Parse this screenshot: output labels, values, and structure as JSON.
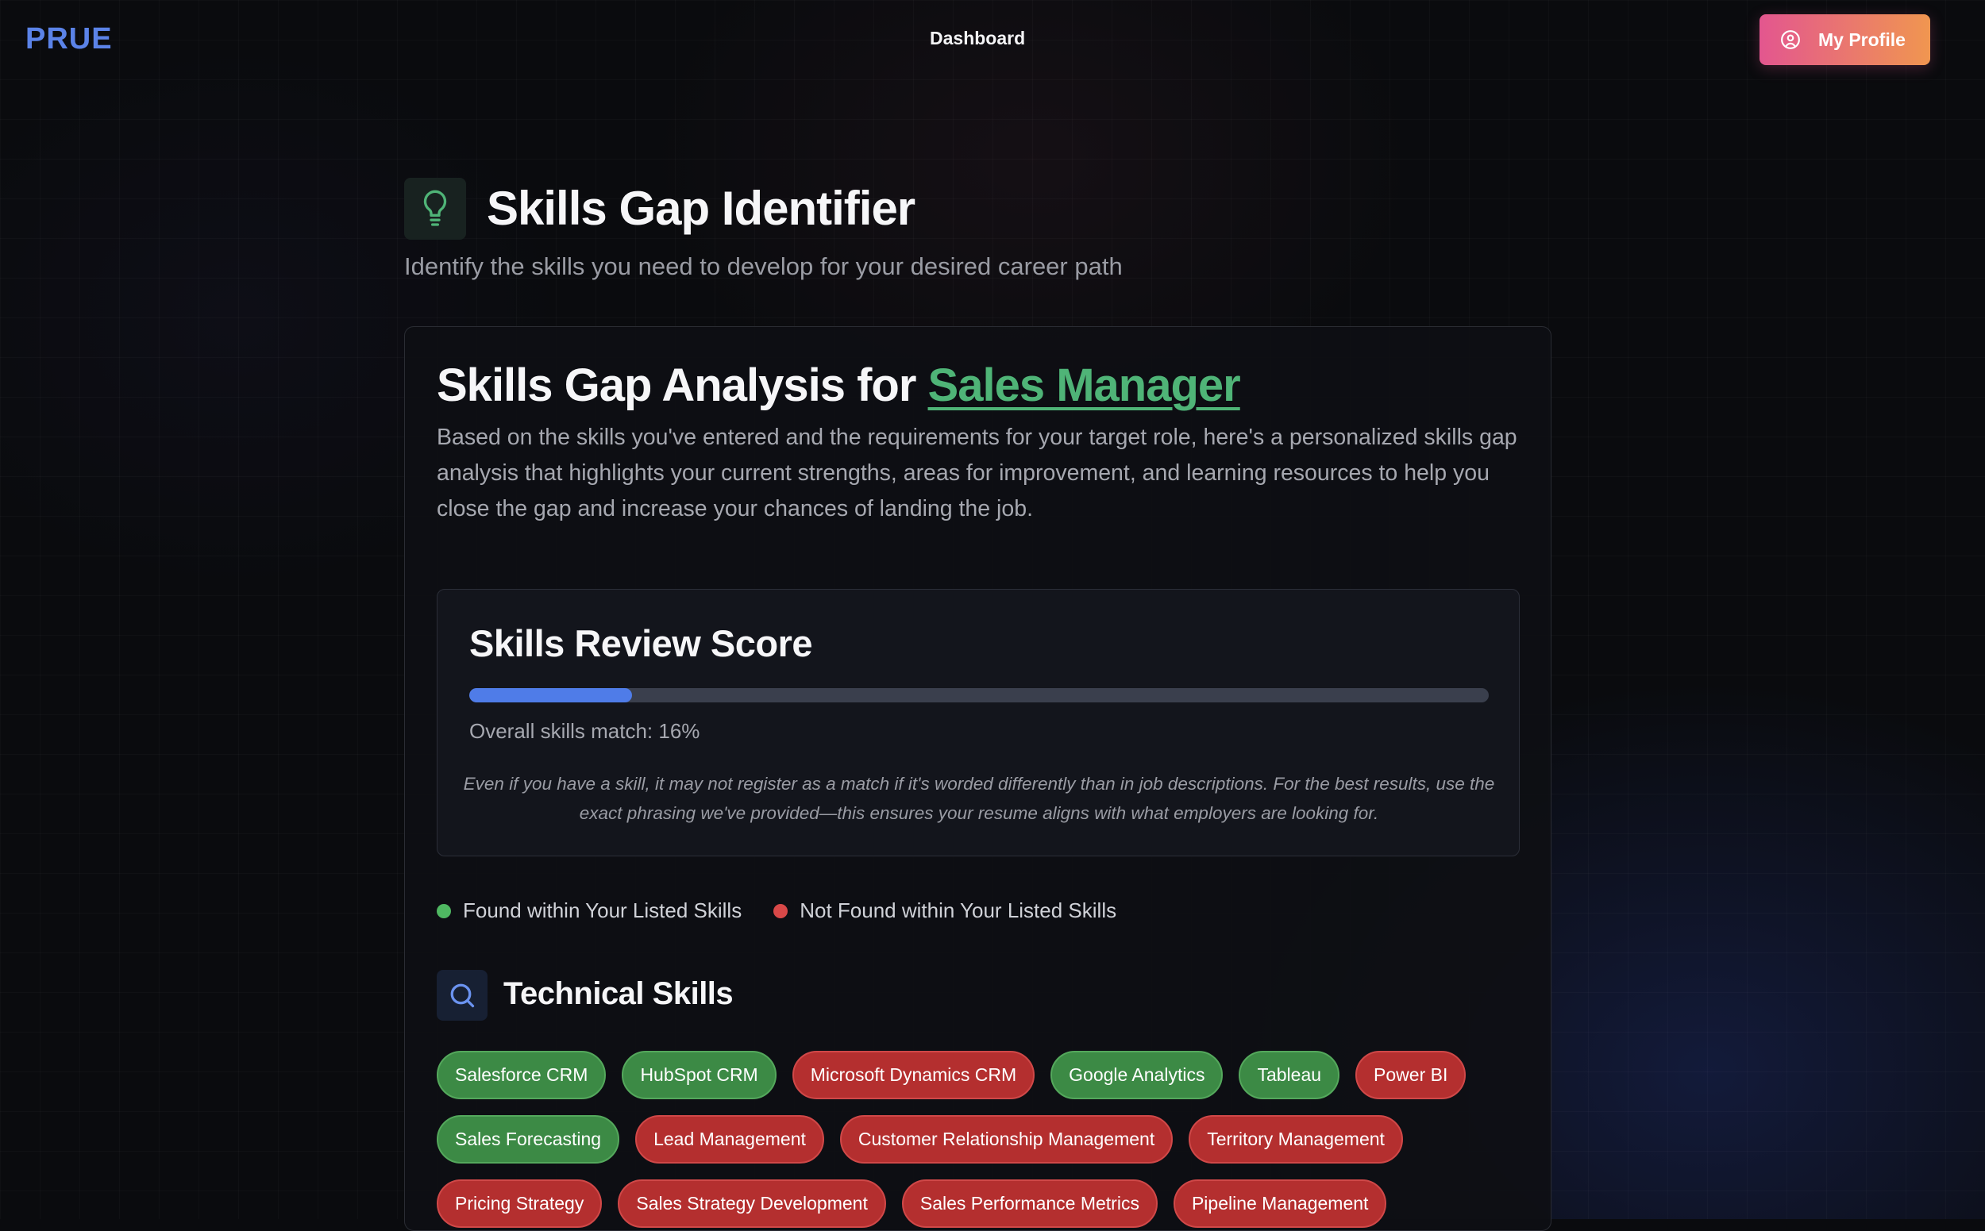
{
  "nav": {
    "logo": "PRUE",
    "link": "Dashboard",
    "profile_button": "My Profile"
  },
  "header": {
    "icon": "lightbulb-icon",
    "title": "Skills Gap Identifier",
    "subtitle": "Identify the skills you need to develop for your desired career path"
  },
  "analysis": {
    "title_prefix": "Skills Gap Analysis for ",
    "role": "Sales Manager",
    "description": "Based on the skills you've entered and the requirements for your target role, here's a personalized skills gap analysis that highlights your current strengths, areas for improvement, and learning resources to help you close the gap and increase your chances of landing the job."
  },
  "score": {
    "title": "Skills Review Score",
    "match_percent": 16,
    "match_text": "Overall skills match: 16%",
    "note": "Even if you have a skill, it may not register as a match if it's worded differently than in job descriptions. For the best results, use the exact phrasing we've provided—this ensures your resume aligns with what employers are looking for."
  },
  "legend": {
    "found": "Found within Your Listed Skills",
    "not_found": "Not Found within Your Listed Skills",
    "found_color": "#4fb862",
    "not_found_color": "#d84848"
  },
  "technical": {
    "icon": "search-icon",
    "title": "Technical Skills",
    "skills": [
      {
        "name": "Salesforce CRM",
        "found": true
      },
      {
        "name": "HubSpot CRM",
        "found": true
      },
      {
        "name": "Microsoft Dynamics CRM",
        "found": false
      },
      {
        "name": "Google Analytics",
        "found": true
      },
      {
        "name": "Tableau",
        "found": true
      },
      {
        "name": "Power BI",
        "found": false
      },
      {
        "name": "Sales Forecasting",
        "found": true
      },
      {
        "name": "Lead Management",
        "found": false
      },
      {
        "name": "Customer Relationship Management",
        "found": false
      },
      {
        "name": "Territory Management",
        "found": false
      },
      {
        "name": "Pricing Strategy",
        "found": false
      },
      {
        "name": "Sales Strategy Development",
        "found": false
      },
      {
        "name": "Sales Performance Metrics",
        "found": false
      },
      {
        "name": "Pipeline Management",
        "found": false
      }
    ]
  }
}
